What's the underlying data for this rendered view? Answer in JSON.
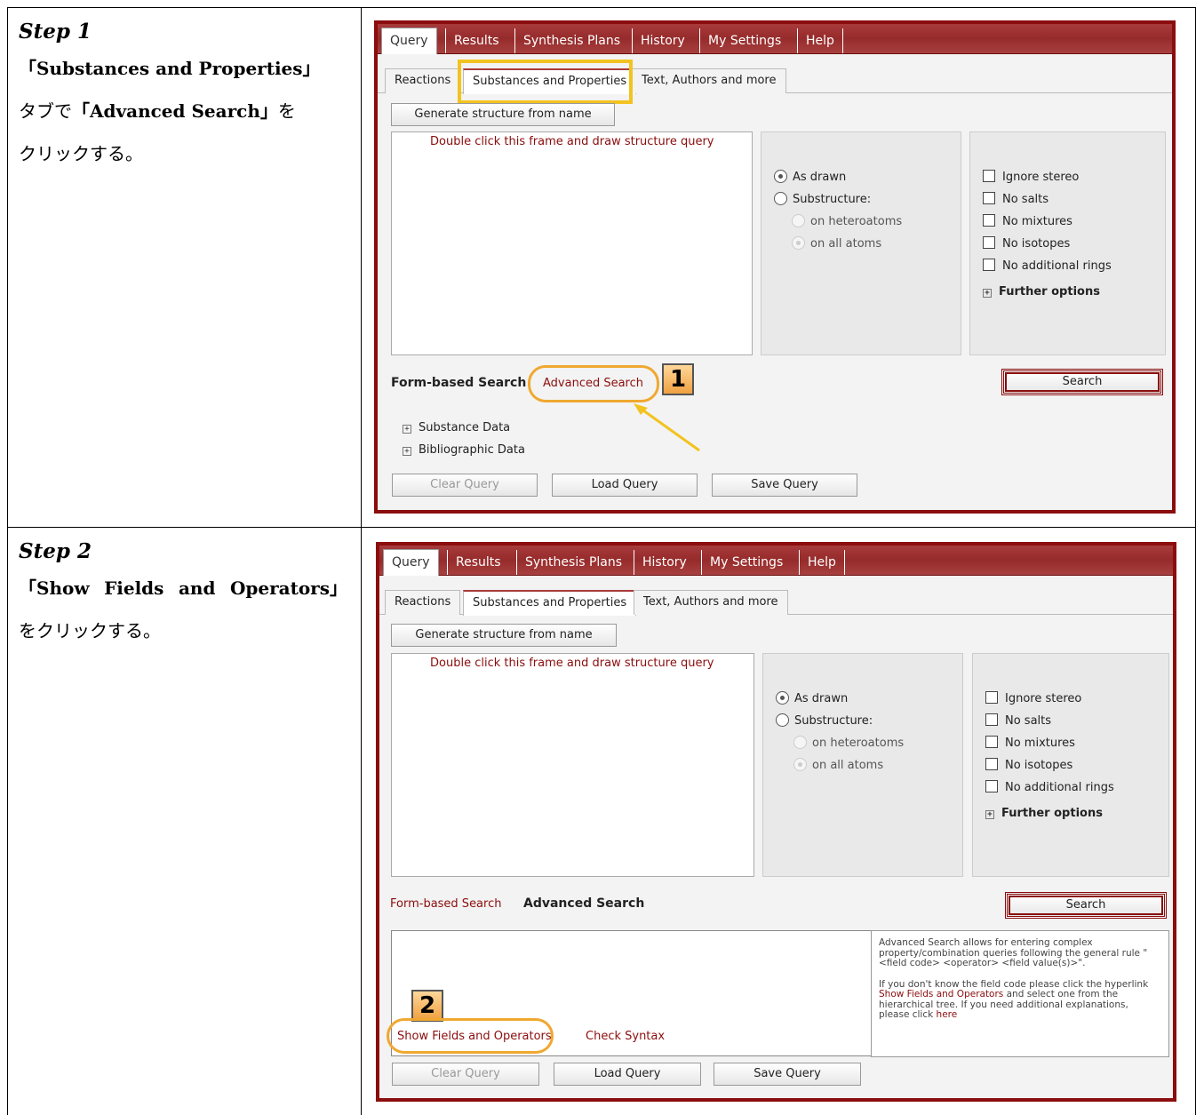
{
  "steps": [
    {
      "title": "Step 1",
      "line1": "「Substances and Properties」",
      "line2_pre": "タブで",
      "line2_bold": "「Advanced Search」",
      "line2_post": "を",
      "line3": "クリックする。"
    },
    {
      "title": "Step 2",
      "line1_parts": [
        "「Show",
        "Fields",
        "and",
        "Operators」"
      ],
      "line2": "をクリックする。"
    }
  ],
  "app": {
    "menu": [
      "Query",
      "Results",
      "Synthesis Plans",
      "History",
      "My Settings",
      "Help"
    ],
    "tabs": [
      "Reactions",
      "Substances and Properties",
      "Text, Authors and more"
    ],
    "generate_button": "Generate structure from name",
    "draw_hint": "Double click this frame and draw structure query",
    "radio_options": [
      "As drawn",
      "Substructure:",
      "on heteroatoms",
      "on all atoms"
    ],
    "checkbox_options": [
      "Ignore stereo",
      "No salts",
      "No mixtures",
      "No isotopes",
      "No additional rings"
    ],
    "further_options": "Further options",
    "search_button": "Search",
    "form_based_search": "Form-based Search",
    "advanced_search": "Advanced Search",
    "substance_data": "Substance Data",
    "bibliographic_data": "Bibliographic Data",
    "clear_query": "Clear Query",
    "load_query": "Load Query",
    "save_query": "Save Query",
    "show_fields": "Show Fields and Operators",
    "check_syntax": "Check Syntax",
    "info_p1": "Advanced Search allows for entering complex property/combination queries following the general rule \"<field code> <operator> <field value(s)>\".",
    "info_p2_pre": "If you don't know the field code please click the hyperlink ",
    "info_p2_link": "Show Fields and Operators",
    "info_p2_mid": " and select one from the hierarchical tree. If you need additional explanations, please click ",
    "info_p2_here": "here"
  },
  "badges": [
    "1",
    "2"
  ],
  "colors": {
    "accent": "#8b0d0d",
    "highlight": "#f2c320",
    "callout": "#f0a830"
  }
}
